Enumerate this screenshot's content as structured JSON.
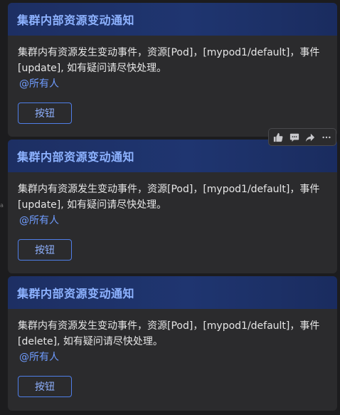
{
  "cards": [
    {
      "title": "集群内部资源变动通知",
      "line1": "集群内有资源发生变动事件，资源[Pod]，[mypod1/default]，事件",
      "line2": "[update], 如有疑问请尽快处理。",
      "mention": "@所有人",
      "button_label": "按钮"
    },
    {
      "title": "集群内部资源变动通知",
      "line1": "集群内有资源发生变动事件，资源[Pod]，[mypod1/default]，事件",
      "line2": "[update], 如有疑问请尽快处理。",
      "mention": "@所有人",
      "button_label": "按钮"
    },
    {
      "title": "集群内部资源变动通知",
      "line1": "集群内有资源发生变动事件，资源[Pod]，[mypod1/default]，事件",
      "line2": "[delete], 如有疑问请尽快处理。",
      "mention": "@所有人",
      "button_label": "按钮"
    }
  ],
  "toolbar": {
    "icons": [
      "thumbs-up-icon",
      "comment-icon",
      "share-icon",
      "more-icon"
    ]
  },
  "colors": {
    "background": "#1c1c1e",
    "card": "#2b2b2d",
    "header_gradient": "#1f3570",
    "title": "#8db2ff",
    "mention": "#6f9cff",
    "button_border": "#4f7ee8"
  }
}
